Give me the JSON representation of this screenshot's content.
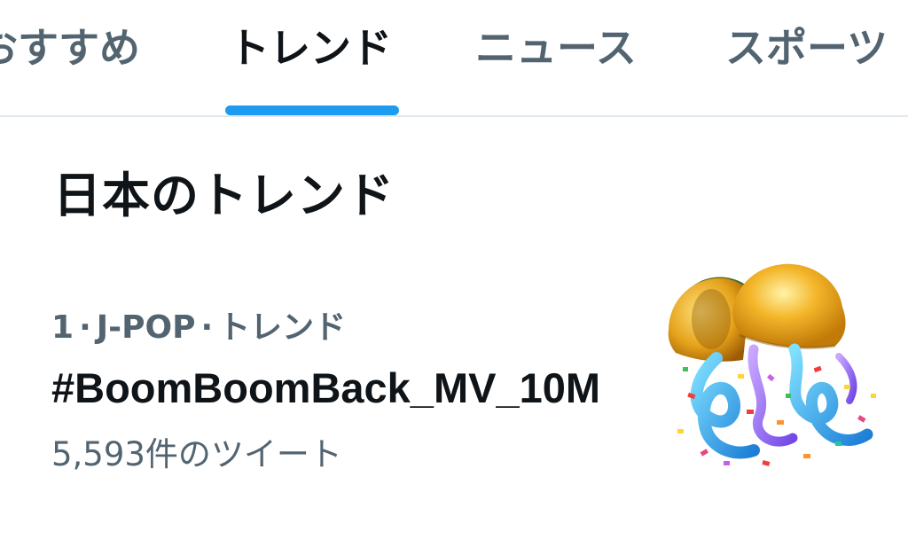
{
  "tabs": [
    {
      "label": "おすすめ",
      "active": false
    },
    {
      "label": "トレンド",
      "active": true
    },
    {
      "label": "ニュース",
      "active": false
    },
    {
      "label": "スポーツ",
      "active": false
    }
  ],
  "section": {
    "heading": "日本のトレンド"
  },
  "trend": {
    "rank": "1",
    "category": "J-POP",
    "type": "トレンド",
    "separator": "·",
    "title": "#BoomBoomBack_MV_10M",
    "tweet_count": "5,593件のツイート",
    "image_icon": "kusudama-party-popper-icon"
  },
  "colors": {
    "accent": "#1d9bf0",
    "text_primary": "#0f1419",
    "text_secondary": "#536471",
    "divider": "#e1e8ed"
  }
}
